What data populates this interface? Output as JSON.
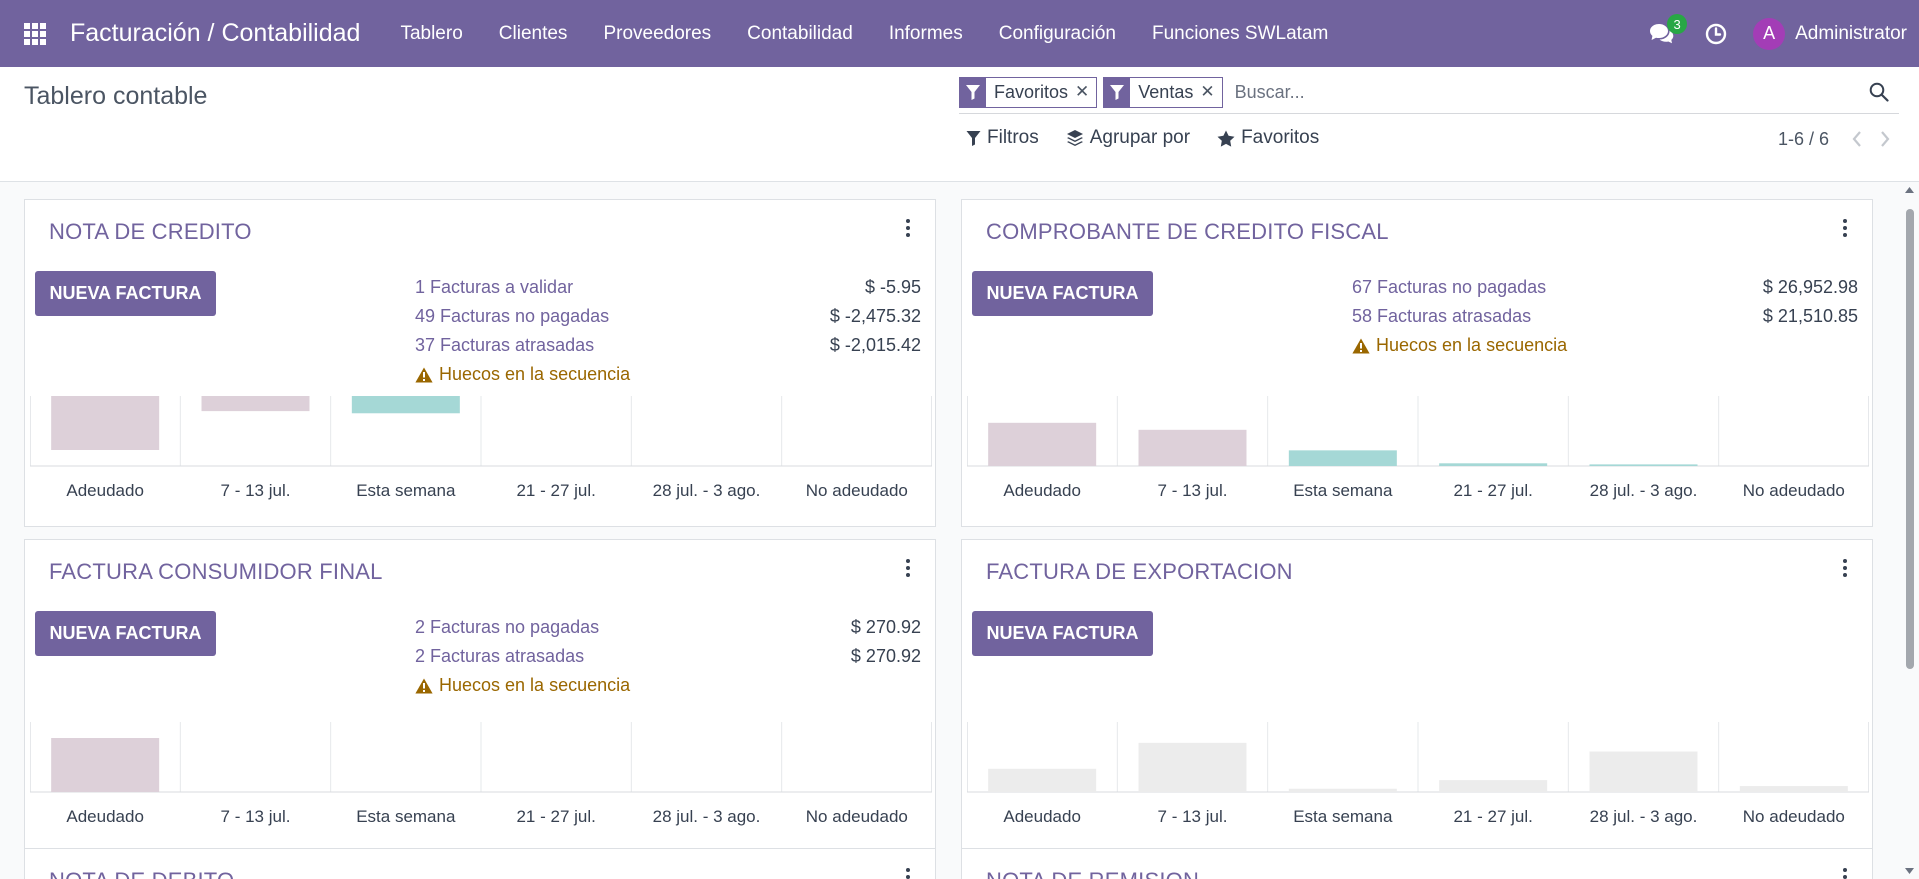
{
  "navbar": {
    "app_title": "Facturación / Contabilidad",
    "menu": [
      "Tablero",
      "Clientes",
      "Proveedores",
      "Contabilidad",
      "Informes",
      "Configuración",
      "Funciones SWLatam"
    ],
    "messages_count": "3",
    "user_initial": "A",
    "user_name": "Administrator",
    "avatar_color": "#a33db6",
    "brand_color": "#71639e"
  },
  "control_panel": {
    "title": "Tablero contable",
    "facets": [
      {
        "label": "Favoritos",
        "icon": "filter-icon"
      },
      {
        "label": "Ventas",
        "icon": "filter-icon"
      }
    ],
    "search_placeholder": "Buscar...",
    "filters_label": "Filtros",
    "group_by_label": "Agrupar por",
    "favorites_label": "Favoritos",
    "pager": "1-6 / 6"
  },
  "cards": [
    {
      "title": "NOTA DE CREDITO",
      "button": "NUEVA FACTURA",
      "stats": [
        {
          "label": "1 Facturas a validar",
          "amount": "$ -5.95"
        },
        {
          "label": "49 Facturas no pagadas",
          "amount": "$ -2,475.32"
        },
        {
          "label": "37 Facturas atrasadas",
          "amount": "$ -2,015.42"
        }
      ],
      "warning": "Huecos en la secuencia"
    },
    {
      "title": "COMPROBANTE DE CREDITO FISCAL",
      "button": "NUEVA FACTURA",
      "stats": [
        {
          "label": "67 Facturas no pagadas",
          "amount": "$ 26,952.98"
        },
        {
          "label": "58 Facturas atrasadas",
          "amount": "$ 21,510.85"
        }
      ],
      "warning": "Huecos en la secuencia"
    },
    {
      "title": "FACTURA CONSUMIDOR FINAL",
      "button": "NUEVA FACTURA",
      "stats": [
        {
          "label": "2 Facturas no pagadas",
          "amount": "$ 270.92"
        },
        {
          "label": "2 Facturas atrasadas",
          "amount": "$ 270.92"
        }
      ],
      "warning": "Huecos en la secuencia"
    },
    {
      "title": "FACTURA DE EXPORTACION",
      "button": "NUEVA FACTURA",
      "stats": [],
      "warning": ""
    },
    {
      "title": "NOTA DE DEBITO",
      "button": "",
      "stats": [],
      "warning": ""
    },
    {
      "title": "NOTA DE REMISION",
      "button": "",
      "stats": [],
      "warning": ""
    }
  ],
  "chart_data": [
    {
      "type": "bar",
      "categories": [
        "Adeudado",
        "7 - 13 jul.",
        "Esta semana",
        "21 - 27 jul.",
        "28 jul. - 3 ago.",
        "No adeudado"
      ],
      "values": [
        -1.0,
        -0.28,
        -0.32,
        0,
        0,
        0
      ],
      "colors": [
        "#ddd0d9",
        "#ddd0d9",
        "#a5d8d6",
        "#ddd0d9",
        "#ddd0d9",
        "#ddd0d9"
      ],
      "grid": true
    },
    {
      "type": "bar",
      "categories": [
        "Adeudado",
        "7 - 13 jul.",
        "Esta semana",
        "21 - 27 jul.",
        "28 jul. - 3 ago.",
        "No adeudado"
      ],
      "values": [
        0.8,
        0.67,
        0.29,
        0.05,
        0.03,
        0
      ],
      "colors": [
        "#ddd0d9",
        "#ddd0d9",
        "#a5d8d6",
        "#a5d8d6",
        "#a5d8d6",
        "#a5d8d6"
      ],
      "grid": true
    },
    {
      "type": "bar",
      "categories": [
        "Adeudado",
        "7 - 13 jul.",
        "Esta semana",
        "21 - 27 jul.",
        "28 jul. - 3 ago.",
        "No adeudado"
      ],
      "values": [
        1.0,
        0,
        0,
        0,
        0,
        0
      ],
      "colors": [
        "#ddd0d9",
        "#ddd0d9",
        "#a5d8d6",
        "#a5d8d6",
        "#a5d8d6",
        "#a5d8d6"
      ],
      "grid": true
    },
    {
      "type": "bar",
      "categories": [
        "Adeudado",
        "7 - 13 jul.",
        "Esta semana",
        "21 - 27 jul.",
        "28 jul. - 3 ago.",
        "No adeudado"
      ],
      "values": [
        0.43,
        0.91,
        0.06,
        0.22,
        0.75,
        0.11
      ],
      "colors": [
        "#ececec",
        "#ececec",
        "#ececec",
        "#ececec",
        "#ececec",
        "#ececec"
      ],
      "grid": true
    }
  ]
}
